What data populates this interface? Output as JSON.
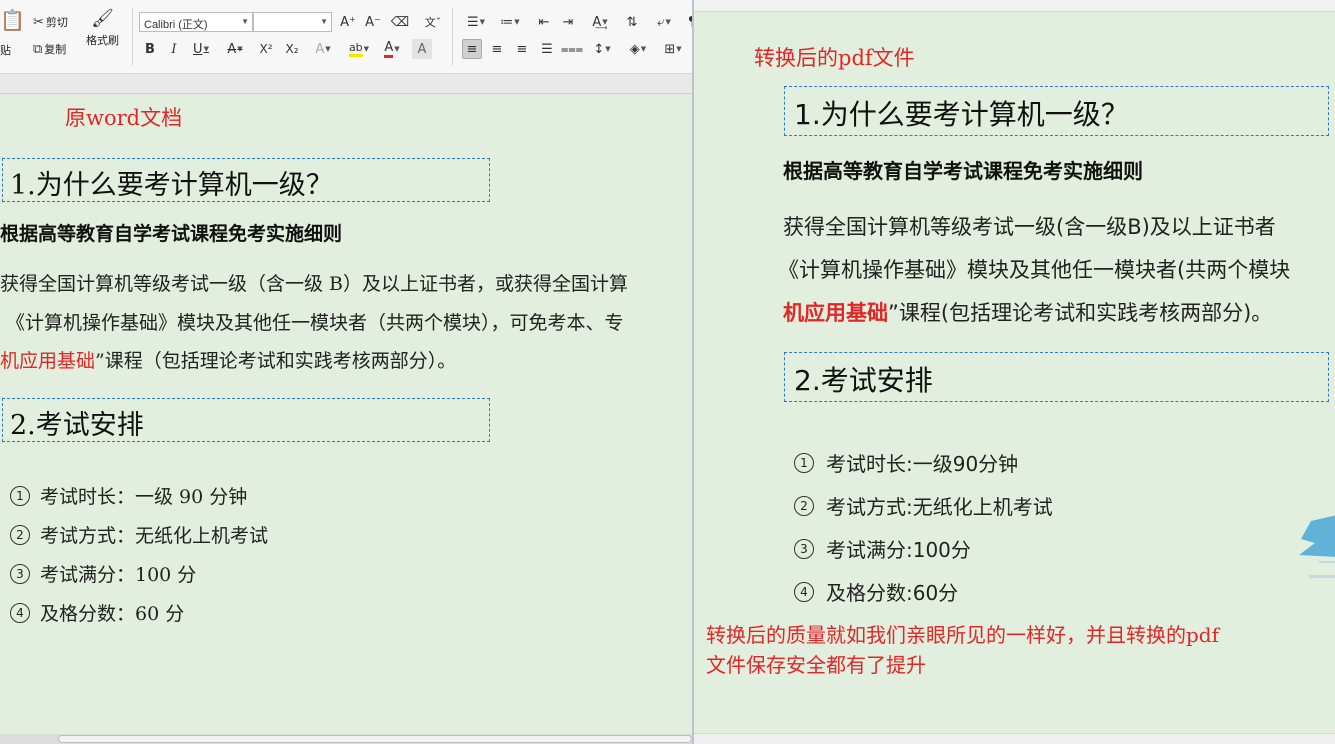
{
  "ribbon": {
    "paste_label": "贴",
    "cut_label": "剪切",
    "copy_label": "复制",
    "format_painter_label": "格式刷",
    "font_name": "Calibri (正文)",
    "font_size": "",
    "bold": "B",
    "italic": "I",
    "underline": "U",
    "strike": "A",
    "superscript": "X²",
    "subscript": "X₂",
    "font_color_glyph": "A"
  },
  "left_doc": {
    "caption": "原word文档",
    "heading1": "1.为什么要考计算机一级？",
    "bold_line": "根据高等教育自学考试课程免考实施细则",
    "para_line1": "获得全国计算机等级考试一级（含一级 B）及以上证书者，或获得全国计算",
    "para_line2": "《计算机操作基础》模块及其他任一模块者（共两个模块），可免考本、专",
    "para_line3_red": "机应用基础",
    "para_line3_rest": "”课程（包括理论考试和实践考核两部分）。",
    "heading2": "2.考试安排",
    "items": [
      {
        "num": "1",
        "text": "考试时长：一级 90 分钟"
      },
      {
        "num": "2",
        "text": "考试方式：无纸化上机考试"
      },
      {
        "num": "3",
        "text": "考试满分：100 分"
      },
      {
        "num": "4",
        "text": "及格分数：60 分"
      }
    ]
  },
  "right_doc": {
    "caption": "转换后的pdf文件",
    "heading1": "1.为什么要考计算机一级？",
    "bold_line": "根据高等教育自学考试课程免考实施细则",
    "para_line1": "获得全国计算机等级考试一级(含一级B)及以上证书者",
    "para_line2": "《计算机操作基础》模块及其他任一模块者(共两个模块",
    "para_line3_red": "机应用基础",
    "para_line3_rest": "”课程(包括理论考试和实践考核两部分)。",
    "heading2": "2.考试安排",
    "items": [
      {
        "num": "1",
        "text": "考试时长:一级90分钟"
      },
      {
        "num": "2",
        "text": "考试方式:无纸化上机考试"
      },
      {
        "num": "3",
        "text": "考试满分:100分"
      },
      {
        "num": "4",
        "text": "及格分数:60分"
      }
    ],
    "footer_line1": "转换后的质量就如我们亲眼所见的一样好，并且转换的pdf",
    "footer_line2": "文件保存安全都有了提升"
  },
  "colors": {
    "page_bg": "#e3efde",
    "red_text": "#e12626",
    "dash_box": "#2f7ac9"
  }
}
